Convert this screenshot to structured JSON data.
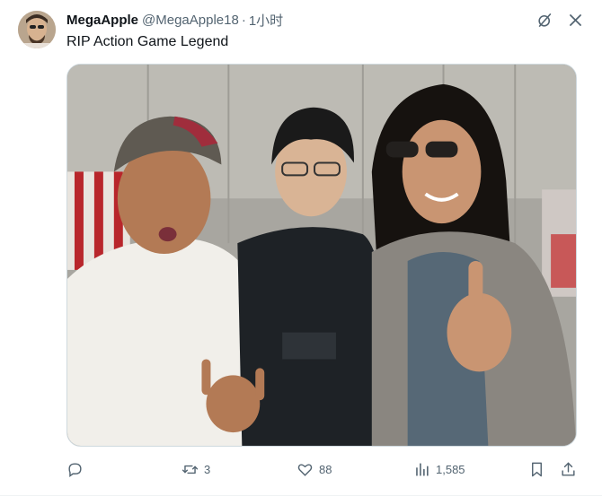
{
  "tweet": {
    "author": {
      "display_name": "MegaApple",
      "handle": "@MegaApple18",
      "separator": "·",
      "time": "1小时",
      "avatar_icon": "avatar-image"
    },
    "text": "RIP Action Game Legend",
    "media": {
      "type": "photo"
    },
    "top_icons": [
      "grok-icon",
      "more-icon"
    ],
    "actions": {
      "reply": {
        "icon": "reply-icon",
        "count": ""
      },
      "retweet": {
        "icon": "retweet-icon",
        "count": "3"
      },
      "like": {
        "icon": "like-icon",
        "count": "88"
      },
      "views": {
        "icon": "views-icon",
        "count": "1,585"
      },
      "bookmark": {
        "icon": "bookmark-icon"
      },
      "share": {
        "icon": "share-icon"
      }
    }
  },
  "colors": {
    "text_primary": "#0f1419",
    "text_secondary": "#536471",
    "border": "#cfd9de"
  }
}
